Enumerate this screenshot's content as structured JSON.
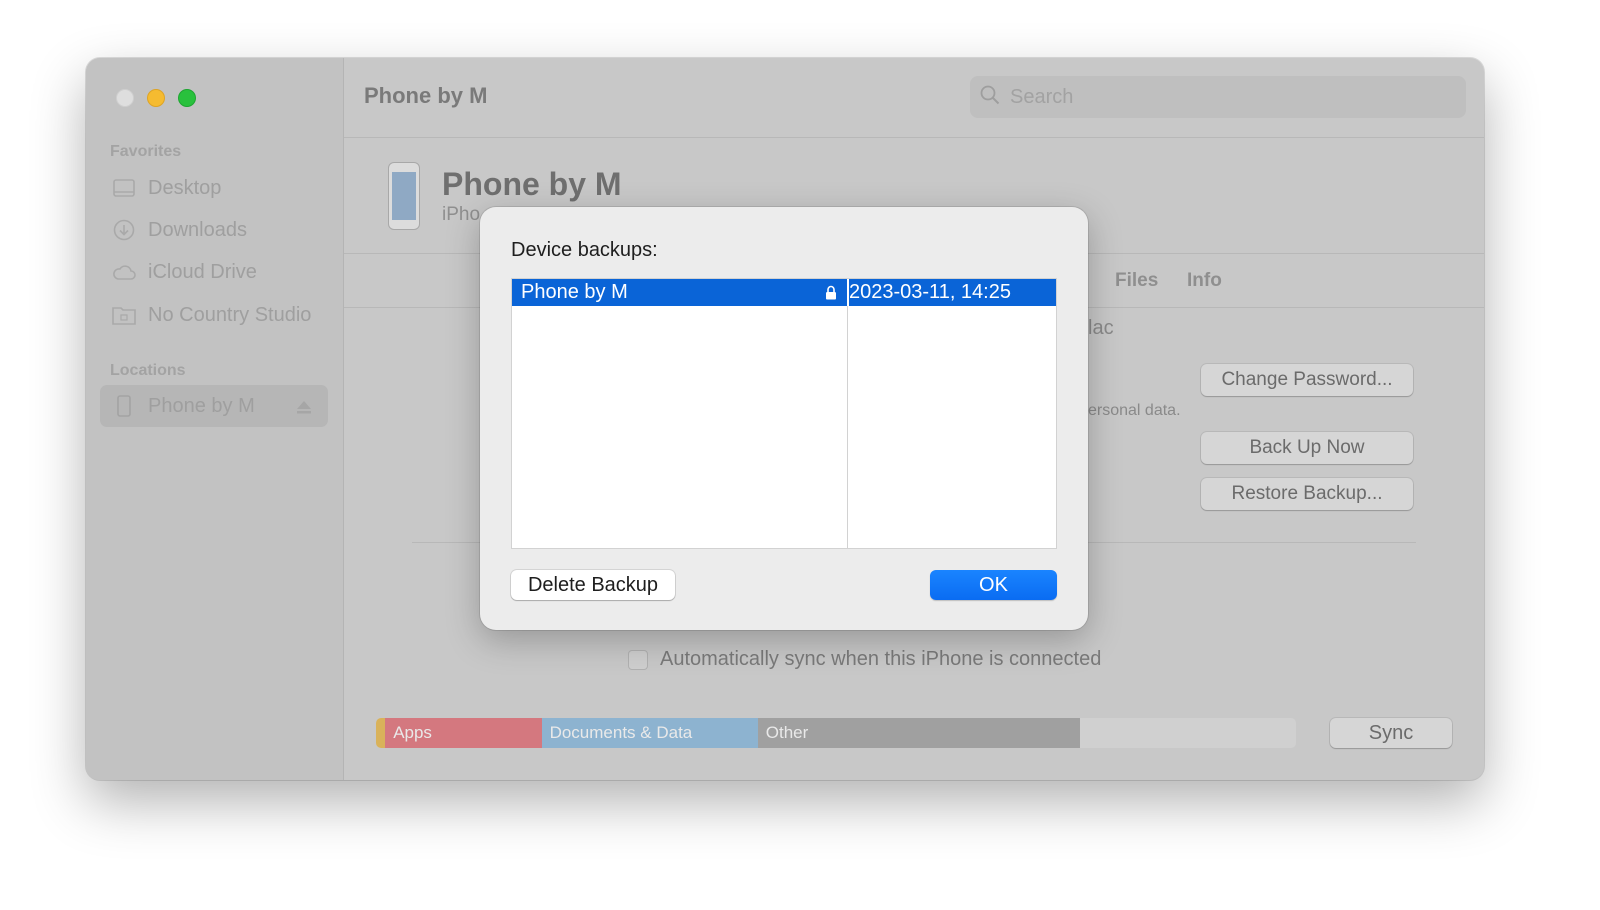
{
  "window": {
    "title": "Phone by M"
  },
  "search": {
    "placeholder": "Search"
  },
  "sidebar": {
    "favorites_label": "Favorites",
    "favorites": [
      {
        "label": "Desktop",
        "icon": "desktop-icon"
      },
      {
        "label": "Downloads",
        "icon": "downloads-icon"
      },
      {
        "label": "iCloud Drive",
        "icon": "icloud-icon"
      },
      {
        "label": "No Country Studio",
        "icon": "folder-icon"
      }
    ],
    "locations_label": "Locations",
    "locations": [
      {
        "label": "Phone by M",
        "icon": "iphone-icon",
        "selected": true
      }
    ]
  },
  "device": {
    "name": "Phone by M",
    "subtitle": "iPho"
  },
  "tabs": {
    "files": "Files",
    "info": "Info"
  },
  "background": {
    "mac_fragment": "lac",
    "personal_data_fragment": "ersonal data.",
    "change_password": "Change Password...",
    "back_up_now": "Back Up Now",
    "restore_backup": "Restore Backup...",
    "auto_sync_label": "Automatically sync when this iPhone is connected",
    "sync": "Sync"
  },
  "storage": {
    "segments": [
      {
        "label": "",
        "color": "#d9b25a",
        "fraction": 0.01
      },
      {
        "label": "Apps",
        "color": "#d4787f",
        "fraction": 0.17
      },
      {
        "label": "Documents & Data",
        "color": "#8db3d0",
        "fraction": 0.235
      },
      {
        "label": "Other",
        "color": "#a0a0a0",
        "fraction": 0.35
      }
    ]
  },
  "dialog": {
    "title": "Device backups:",
    "backups": [
      {
        "name": "Phone by M",
        "locked": true,
        "date": "2023-03-11, 14:25",
        "selected": true
      }
    ],
    "delete_label": "Delete Backup",
    "ok_label": "OK",
    "colors": {
      "accent": "#0a64d7"
    }
  }
}
